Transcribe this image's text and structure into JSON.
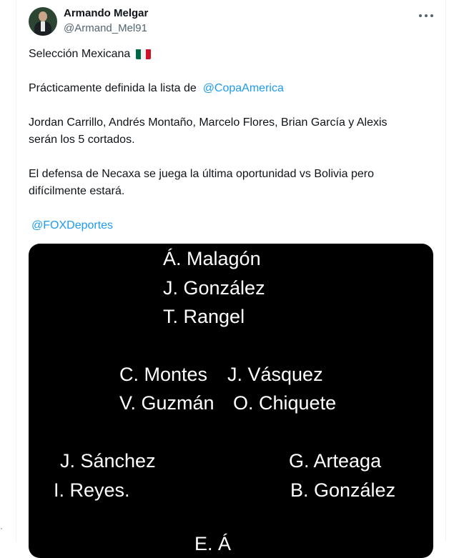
{
  "tweet": {
    "author_name": "Armando Melgar",
    "author_handle": "@Armand_Mel91",
    "line1": "Selección Mexicana",
    "line2_text": "Prácticamente definida la lista de",
    "line2_mention": "@CopaAmerica",
    "line3a": "Jordan Carrillo, Andrés Montaño, Marcelo Flores, Brian García y Alexis",
    "line3b": "serán los 5 cortados.",
    "line4a": "El defensa de Necaxa se juega la última oportunidad vs Bolivia pero",
    "line4b": "difícilmente estará.",
    "mention2": "@FOXDeportes",
    "flag_icon": "mexico-flag-icon",
    "more_icon": "more-options-icon"
  },
  "lineup_image": {
    "goalkeepers": [
      "Á. Malagón",
      "J. González",
      "T. Rangel"
    ],
    "center_left": [
      "C. Montes",
      "V. Guzmán"
    ],
    "center_right": [
      "J. Vásquez",
      "O. Chiquete"
    ],
    "fullbacks_left": [
      "J. Sánchez",
      "I. Reyes."
    ],
    "fullbacks_right": [
      "G. Arteaga",
      "B. González"
    ],
    "partial_bottom": "E. Á"
  },
  "colors": {
    "link": "#1d9bf0",
    "text": "#0f1419",
    "secondary": "#536471",
    "media_bg": "#000000",
    "flag": [
      "#006847",
      "#ffffff",
      "#ce1126"
    ]
  }
}
